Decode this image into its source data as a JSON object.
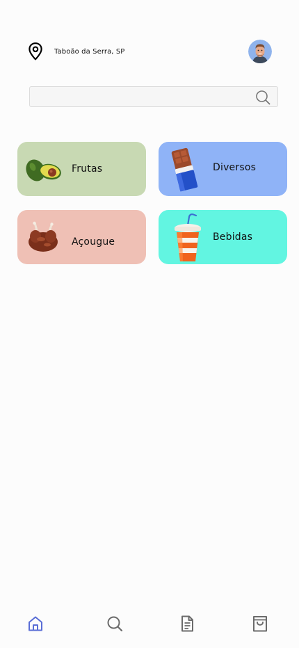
{
  "header": {
    "location": "Taboão da Serra, SP"
  },
  "search": {
    "placeholder": "",
    "value": ""
  },
  "categories": [
    {
      "label": "Frutas",
      "color": "#c8d9b3",
      "icon": "avocado-icon"
    },
    {
      "label": "Diversos",
      "color": "#8fb3f7",
      "icon": "chocolate-bar-icon"
    },
    {
      "label": "Açougue",
      "color": "#efc0b5",
      "icon": "roast-chicken-icon"
    },
    {
      "label": "Bebidas",
      "color": "#62f5e1",
      "icon": "drink-cup-icon"
    }
  ],
  "bottom_nav": {
    "active": "home",
    "accent": "#5a6ed6",
    "items": [
      "home-icon",
      "search-icon",
      "orders-icon",
      "shopping-bag-icon"
    ]
  }
}
